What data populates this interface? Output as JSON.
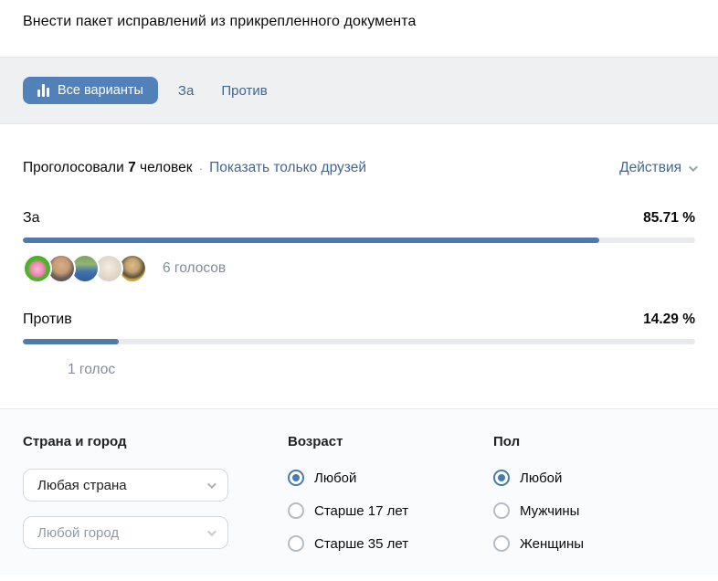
{
  "header": {
    "title": "Внести пакет исправлений из прикрепленного документа"
  },
  "tabs": {
    "all_label": "Все варианты",
    "for_label": "За",
    "against_label": "Против"
  },
  "meta": {
    "voted_prefix": "Проголосовали",
    "voted_count": "7",
    "voted_suffix": "человек",
    "separator": "·",
    "friends_link": "Показать только друзей",
    "actions_label": "Действия"
  },
  "chart_data": {
    "type": "bar",
    "title": "Результаты опроса",
    "categories": [
      "За",
      "Против"
    ],
    "values": [
      85.71,
      14.29
    ],
    "votes": [
      6,
      1
    ],
    "total_votes": 7
  },
  "options": [
    {
      "label": "За",
      "percent_text": "85.71 %",
      "percent": 85.71,
      "votes_text": "6 голосов"
    },
    {
      "label": "Против",
      "percent_text": "14.29 %",
      "percent": 14.29,
      "votes_text": "1 голос"
    }
  ],
  "filters": {
    "location_label": "Страна и город",
    "country_value": "Любая страна",
    "city_placeholder": "Любой город",
    "age_label": "Возраст",
    "age_options": [
      "Любой",
      "Старше 17 лет",
      "Старше 35 лет"
    ],
    "age_selected": "Любой",
    "gender_label": "Пол",
    "gender_options": [
      "Любой",
      "Мужчины",
      "Женщины"
    ],
    "gender_selected": "Любой"
  },
  "colors": {
    "accent_button": "#5181b8",
    "link_blue": "#44678d",
    "bar_fill": "#4e7aae",
    "bar_track": "#e8eaed",
    "muted_text": "#818c99",
    "tabs_band_bg": "#eef0f2",
    "filters_bg": "#fafbfc"
  }
}
